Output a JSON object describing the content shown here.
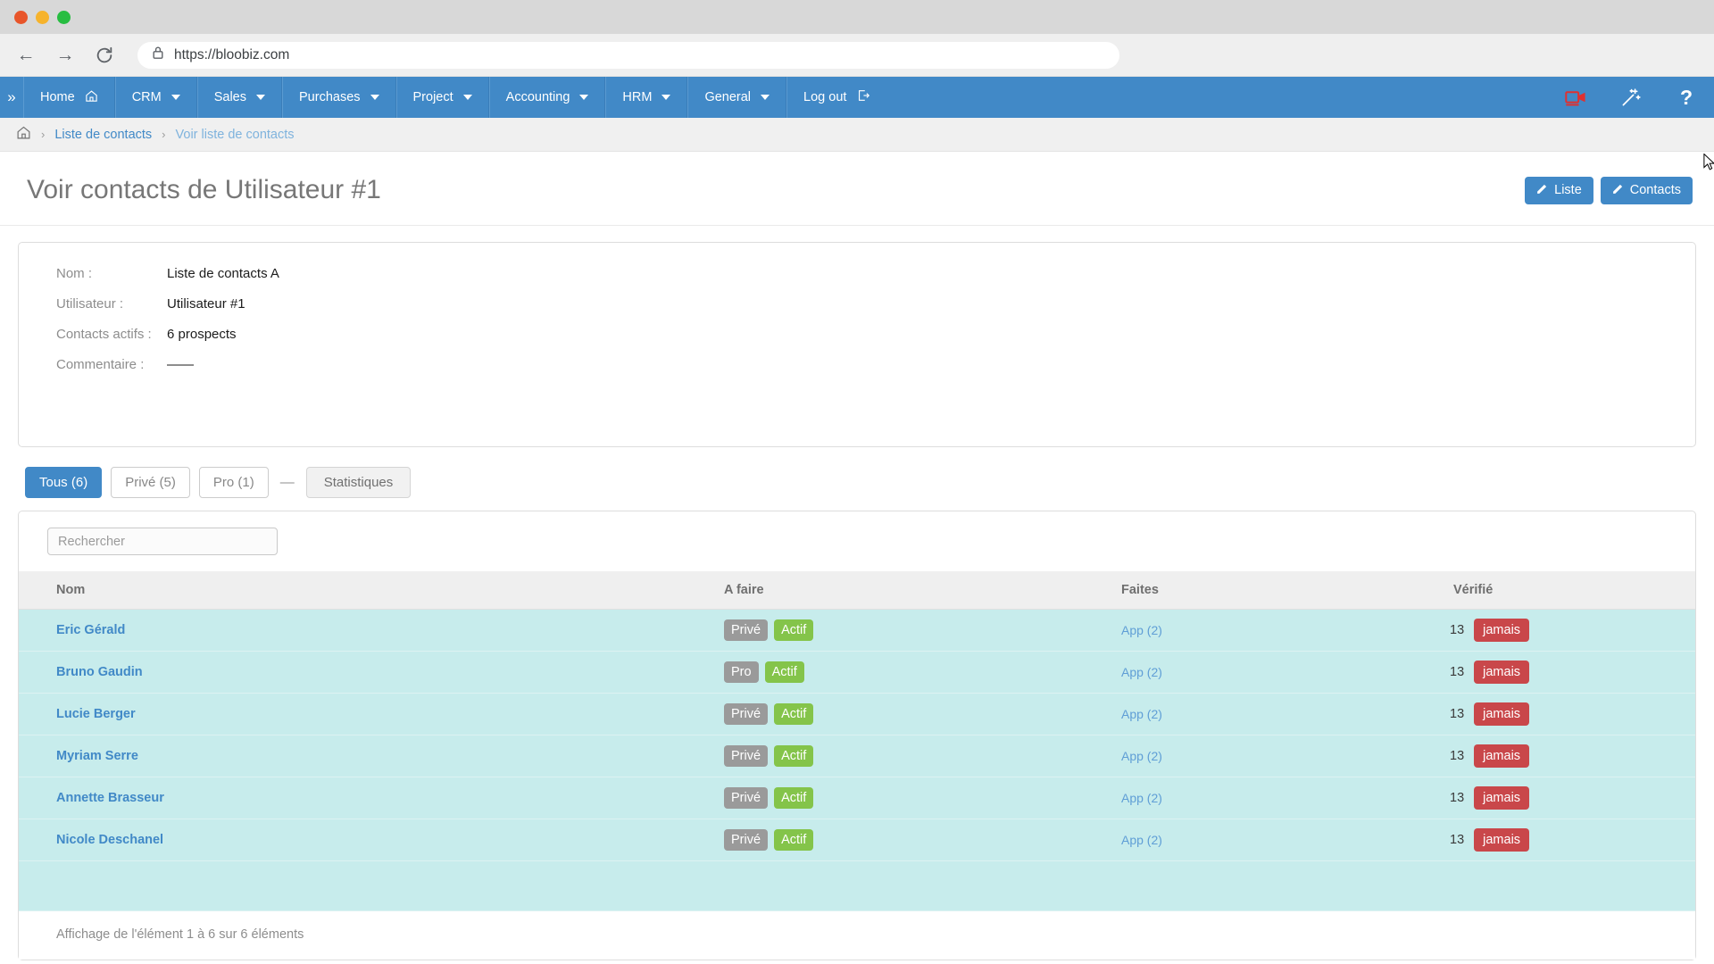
{
  "browser": {
    "window_controls": [
      "close",
      "minimize",
      "maximize"
    ],
    "back_icon": "←",
    "forward_icon": "→",
    "reload_icon": "↻",
    "lock_icon": "lock",
    "url": "https://bloobiz.com"
  },
  "navbar": {
    "expand_icon": "»",
    "items": [
      {
        "label": "Home",
        "icon": "home",
        "caret": false
      },
      {
        "label": "CRM",
        "icon": "",
        "caret": true
      },
      {
        "label": "Sales",
        "icon": "",
        "caret": true
      },
      {
        "label": "Purchases",
        "icon": "",
        "caret": true
      },
      {
        "label": "Project",
        "icon": "",
        "caret": true
      },
      {
        "label": "Accounting",
        "icon": "",
        "caret": true
      },
      {
        "label": "HRM",
        "icon": "",
        "caret": true
      },
      {
        "label": "General",
        "icon": "",
        "caret": true
      },
      {
        "label": "Log out",
        "icon": "logout",
        "caret": false
      }
    ],
    "right_icons": [
      {
        "name": "video-record-icon",
        "glyph": "video",
        "color": "#e03030"
      },
      {
        "name": "magic-wand-icon",
        "glyph": "wand",
        "color": "#ffffff"
      },
      {
        "name": "help-icon",
        "glyph": "?",
        "color": "#ffffff"
      }
    ]
  },
  "breadcrumb": {
    "home_icon": "home",
    "sep": "›",
    "parent": "Liste de contacts",
    "current": "Voir liste de contacts"
  },
  "page": {
    "title": "Voir contacts de Utilisateur #1",
    "actions": [
      {
        "label": "Liste",
        "icon": "pencil"
      },
      {
        "label": "Contacts",
        "icon": "pencil"
      }
    ]
  },
  "info_panel": {
    "rows": [
      {
        "label": "Nom :",
        "value": "Liste de contacts A"
      },
      {
        "label": "Utilisateur :",
        "value": "Utilisateur #1"
      },
      {
        "label": "Contacts actifs :",
        "value": "6 prospects"
      },
      {
        "label": "Commentaire :",
        "value": "——"
      }
    ]
  },
  "tabs": {
    "items": [
      {
        "label": "Tous (6)",
        "active": true
      },
      {
        "label": "Privé (5)",
        "active": false
      },
      {
        "label": "Pro (1)",
        "active": false
      }
    ],
    "dash": "—",
    "stats_label": "Statistiques"
  },
  "table": {
    "search_placeholder": "Rechercher",
    "search_value": "",
    "columns": [
      "Nom",
      "A faire",
      "Faites",
      "Vérifié"
    ],
    "rows": [
      {
        "nom": "Eric Gérald",
        "type": "Privé",
        "statut": "Actif",
        "faites": "App (2)",
        "num": "13",
        "verifie": "jamais"
      },
      {
        "nom": "Bruno Gaudin",
        "type": "Pro",
        "statut": "Actif",
        "faites": "App (2)",
        "num": "13",
        "verifie": "jamais"
      },
      {
        "nom": "Lucie Berger",
        "type": "Privé",
        "statut": "Actif",
        "faites": "App (2)",
        "num": "13",
        "verifie": "jamais"
      },
      {
        "nom": "Myriam Serre",
        "type": "Privé",
        "statut": "Actif",
        "faites": "App (2)",
        "num": "13",
        "verifie": "jamais"
      },
      {
        "nom": "Annette Brasseur",
        "type": "Privé",
        "statut": "Actif",
        "faites": "App (2)",
        "num": "13",
        "verifie": "jamais"
      },
      {
        "nom": "Nicole Deschanel",
        "type": "Privé",
        "statut": "Actif",
        "faites": "App (2)",
        "num": "13",
        "verifie": "jamais"
      }
    ],
    "footer": "Affichage de l'élément 1 à 6 sur 6 éléments"
  },
  "colors": {
    "brand_blue": "#4189c7",
    "row_bg": "#c7ecec",
    "badge_grey": "#9a9a9a",
    "badge_green": "#84c44a",
    "badge_red": "#c9474a"
  }
}
